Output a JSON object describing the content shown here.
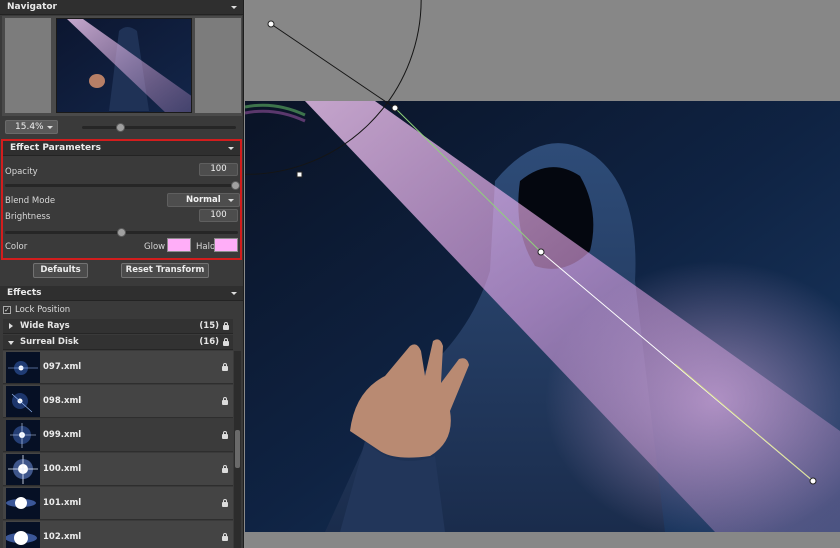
{
  "navigator": {
    "title": "Navigator"
  },
  "zoom": {
    "value": "15.4%",
    "slider_fraction": 0.25
  },
  "effect_parameters": {
    "title": "Effect Parameters",
    "opacity_label": "Opacity",
    "opacity_value": "100",
    "blend_mode_label": "Blend Mode",
    "blend_mode_value": "Normal",
    "brightness_label": "Brightness",
    "brightness_value": "100",
    "color_label": "Color",
    "glow_label": "Glow",
    "halo_label": "Halo",
    "glow_color": "#ffaef8",
    "halo_color": "#ffaef8"
  },
  "buttons": {
    "defaults": "Defaults",
    "reset_transform": "Reset Transform"
  },
  "effects": {
    "title": "Effects",
    "lock_position_label": "Lock Position",
    "lock_position_checked": true,
    "groups": [
      {
        "name": "Wide Rays",
        "count": "(15)",
        "expanded": false
      },
      {
        "name": "Surreal Disk",
        "count": "(16)",
        "expanded": true
      }
    ],
    "presets": [
      "097.xml",
      "098.xml",
      "099.xml",
      "100.xml",
      "101.xml",
      "102.xml"
    ],
    "selected_preset": "099.xml"
  },
  "colors": {
    "accent_red": "#d21d1d",
    "panel_bg": "#3a3a3a",
    "canvas_bg": "#878787"
  }
}
